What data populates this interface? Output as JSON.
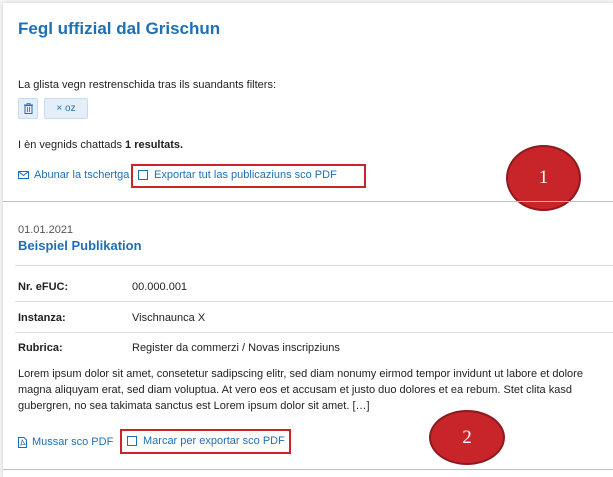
{
  "page": {
    "title": "Fegl uffizial dal Grischun",
    "filter_intro": "La glista vegn restrenschida tras ils suandants filters:",
    "filter_chip_label": "× oz",
    "results_prefix": "I èn vegnids chattads ",
    "results_count": "1 resultats.",
    "subscribe_label": "Abunar la tschertga",
    "export_all_label": "Exportar tut las publicaziuns sco PDF"
  },
  "publication": {
    "date": "01.01.2021",
    "title": "Beispiel Publikation",
    "fields": [
      {
        "label": "Nr. eFUC:",
        "value": "00.000.001"
      },
      {
        "label": "Instanza:",
        "value": "Vischnaunca X"
      },
      {
        "label": "Rubrica:",
        "value": "Register da commerzi / Novas inscripziuns"
      }
    ],
    "body": "Lorem ipsum dolor sit amet, consetetur sadipscing elitr, sed diam nonumy eirmod tempor invidunt ut labore et dolore magna aliquyam erat, sed diam voluptua. At vero eos et accusam et justo duo dolores et ea rebum. Stet clita kasd gubergren, no sea takimata sanctus est Lorem ipsum dolor sit amet. […]",
    "show_pdf_label": "Mussar sco PDF",
    "mark_export_label": "Marcar per exportar sco PDF"
  },
  "annotations": {
    "badge_1": "1",
    "badge_2": "2",
    "highlight_color": "#c8252b"
  },
  "colors": {
    "link": "#1f6fb5",
    "chip_bg": "#e4eef8"
  }
}
